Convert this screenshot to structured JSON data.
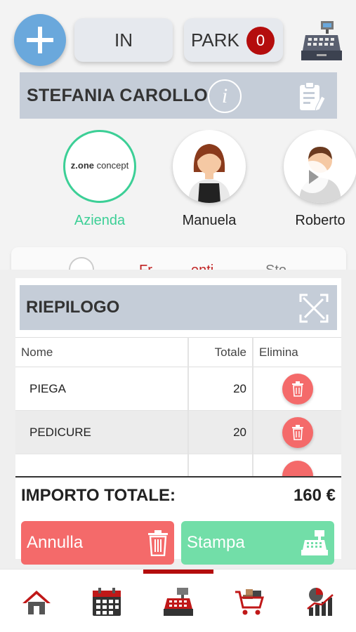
{
  "header": {
    "add_icon": "plus-icon",
    "in_label": "IN",
    "park_label": "PARK",
    "park_count": "0",
    "register_icon": "cash-register-icon"
  },
  "client": {
    "name": "STEFANIA CAROLLO",
    "info_icon": "info-icon",
    "info_glyph": "i",
    "notes_icon": "clipboard-edit-icon"
  },
  "staff": [
    {
      "name": "Azienda",
      "logo_bold": "z.one",
      "logo_rest": " concept",
      "active": true
    },
    {
      "name": "Manuela",
      "active": false
    },
    {
      "name": "Roberto",
      "active": false
    }
  ],
  "peek": {
    "text_red": "Fr",
    "text_red2": "enti",
    "text_gray": "Sto"
  },
  "summary": {
    "title": "RIEPILOGO",
    "expand_icon": "expand-icon",
    "columns": {
      "name": "Nome",
      "total": "Totale",
      "delete": "Elimina"
    },
    "rows": [
      {
        "name": "PIEGA",
        "total": "20"
      },
      {
        "name": "PEDICURE",
        "total": "20"
      }
    ],
    "total_label": "IMPORTO TOTALE:",
    "total_value": "160 €"
  },
  "actions": {
    "cancel_label": "Annulla",
    "print_label": "Stampa"
  },
  "nav": {
    "items": [
      "home-icon",
      "calendar-icon",
      "cash-register-icon",
      "shopping-cart-icon",
      "statistics-icon"
    ],
    "active_index": 2
  },
  "colors": {
    "accent_blue": "#6aa8dc",
    "accent_red": "#b40d0d",
    "accent_green": "#3ccf96",
    "cancel_red": "#f46a6a",
    "print_green": "#72dea8",
    "bar_gray": "#c5cdd8"
  }
}
